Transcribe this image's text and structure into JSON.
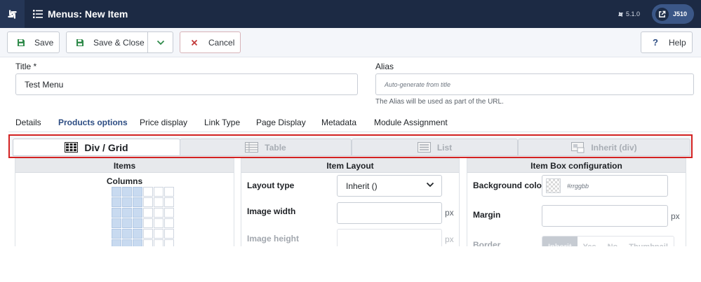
{
  "header": {
    "title": "Menus: New Item",
    "version": "5.1.0",
    "user": "J510"
  },
  "toolbar": {
    "save": "Save",
    "save_close": "Save & Close",
    "cancel": "Cancel",
    "help": "Help"
  },
  "form": {
    "title_label": "Title *",
    "title_value": "Test Menu",
    "alias_label": "Alias",
    "alias_placeholder": "Auto-generate from title",
    "alias_hint": "The Alias will be used as part of the URL."
  },
  "tabs": [
    "Details",
    "Products options",
    "Price display",
    "Link Type",
    "Page Display",
    "Metadata",
    "Module Assignment"
  ],
  "active_tab": 1,
  "subtabs": [
    "Div / Grid",
    "Table",
    "List",
    "Inherit (div)"
  ],
  "active_subtab": 0,
  "items_panel": {
    "title": "Items",
    "columns_label": "Columns",
    "columns_selected": 3,
    "columns_total": 6
  },
  "layout_panel": {
    "title": "Item Layout",
    "layout_type_label": "Layout type",
    "layout_type_value": "Inherit ()",
    "image_width_label": "Image width",
    "image_height_label": "Image height",
    "unit": "px"
  },
  "box_panel": {
    "title": "Item Box configuration",
    "bg_color_label": "Background color",
    "bg_color_placeholder": "#rrggbb",
    "margin_label": "Margin",
    "border_label": "Border",
    "border_options": [
      "Inherit",
      "Yes",
      "No",
      "Thumbnail"
    ],
    "border_selected": 0,
    "unit": "px"
  },
  "colors": {
    "header_bg": "#1c2a44",
    "accent": "#2d4d83",
    "highlight": "#d32222"
  }
}
